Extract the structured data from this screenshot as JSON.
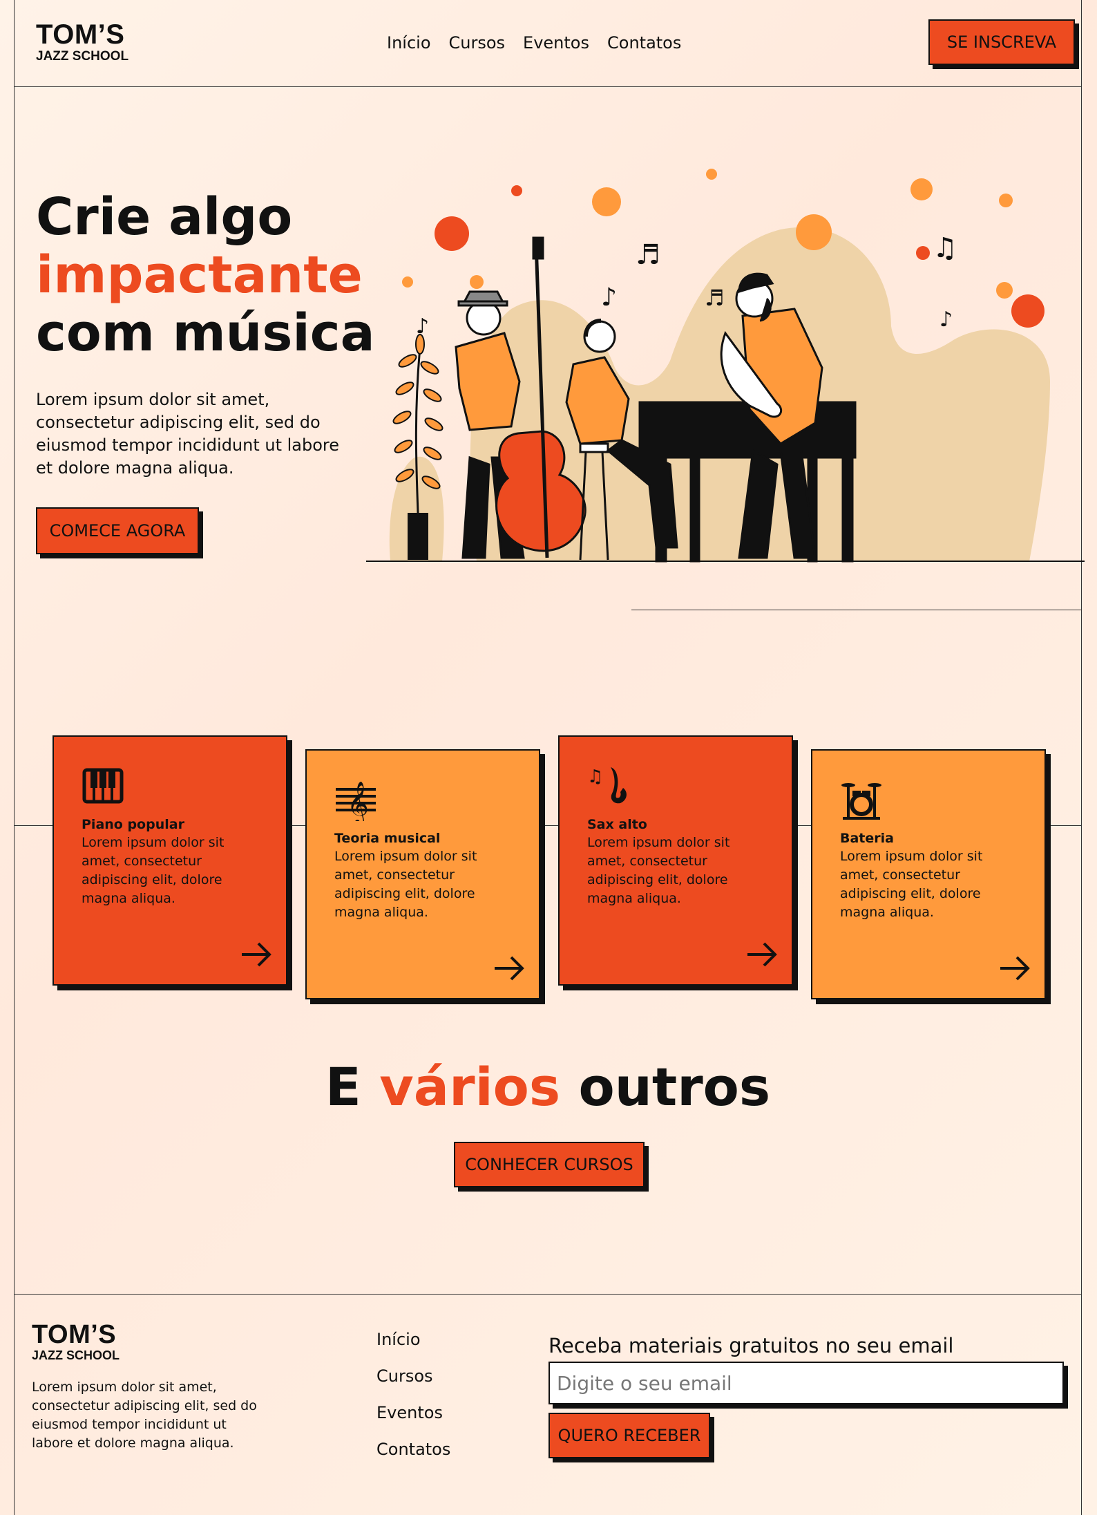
{
  "brand": {
    "name": "TOM’S",
    "tagline": "JAZZ SCHOOL"
  },
  "nav": {
    "items": [
      "Início",
      "Cursos",
      "Eventos",
      "Contatos"
    ],
    "cta": "SE INSCREVA"
  },
  "hero": {
    "title_line1": "Crie algo",
    "title_accent": "impactante",
    "title_line3": "com música",
    "text": "Lorem ipsum dolor sit amet, consectetur adipiscing elit, sed do eiusmod tempor incididunt ut labore et dolore magna aliqua.",
    "cta": "COMECE AGORA",
    "illustration": "jazz-band-illustration"
  },
  "courses": [
    {
      "title": "Piano popular",
      "text": "Lorem ipsum dolor sit amet, consectetur adipiscing elit, dolore magna aliqua.",
      "icon": "piano-icon",
      "color": "#ed4b20"
    },
    {
      "title": "Teoria musical",
      "text": "Lorem ipsum dolor sit amet, consectetur adipiscing elit, dolore magna aliqua.",
      "icon": "treble-clef-icon",
      "color": "#ff9a3c"
    },
    {
      "title": "Sax alto",
      "text": "Lorem ipsum dolor sit amet, consectetur adipiscing elit, dolore magna aliqua.",
      "icon": "saxophone-icon",
      "color": "#ed4b20"
    },
    {
      "title": "Bateria",
      "text": "Lorem ipsum dolor sit amet, consectetur adipiscing elit, dolore magna aliqua.",
      "icon": "drum-kit-icon",
      "color": "#ff9a3c"
    }
  ],
  "others": {
    "prefix": "E",
    "accent": "vários",
    "suffix": "outros",
    "cta": "CONHECER CURSOS"
  },
  "footer": {
    "text": "Lorem ipsum dolor sit amet, consectetur adipiscing elit, sed do eiusmod tempor incididunt ut labore et dolore magna aliqua.",
    "links": [
      "Início",
      "Cursos",
      "Eventos",
      "Contatos"
    ],
    "newsletter_label": "Receba materiais gratuitos no seu email",
    "email_placeholder": "Digite o seu email",
    "cta": "QUERO RECEBER"
  },
  "colors": {
    "accent": "#ed4b20",
    "orange": "#ff9a3c",
    "background": "#fff0e4",
    "ink": "#111111"
  }
}
